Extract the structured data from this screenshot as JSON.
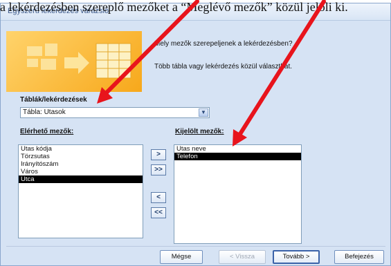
{
  "caption": "a lekérdezésben szereplő mezőket a “Meglévő mezők” közül jelöli ki.",
  "window": {
    "title": "Egyszerű lekérdezés varázsló"
  },
  "description": {
    "line1": "Mely mezők szerepeljenek a lekérdezésben?",
    "line2": "Több tábla vagy lekérdezés közül választhat."
  },
  "tables": {
    "label": "Táblák/lekérdezések",
    "selected": "Tábla: Utasok"
  },
  "available_fields": {
    "label": "Elérhető mezők:",
    "items": [
      "Utas kódja",
      "Törzsutas",
      "Irányítószám",
      "Város",
      "Utca"
    ],
    "selected_index": 4
  },
  "selected_fields": {
    "label": "Kijelölt mezők:",
    "items": [
      "Utas neve",
      "Telefon"
    ],
    "selected_index": 1
  },
  "move_buttons": {
    "add": ">",
    "add_all": ">>",
    "remove": "<",
    "remove_all": "<<"
  },
  "footer": {
    "cancel": "Mégse",
    "back": "< Vissza",
    "next": "Tovább >",
    "finish": "Befejezés"
  },
  "colors": {
    "annotation_arrow": "#e8141c",
    "selection": "#000000",
    "dialog_background": "#d6e3f4"
  }
}
